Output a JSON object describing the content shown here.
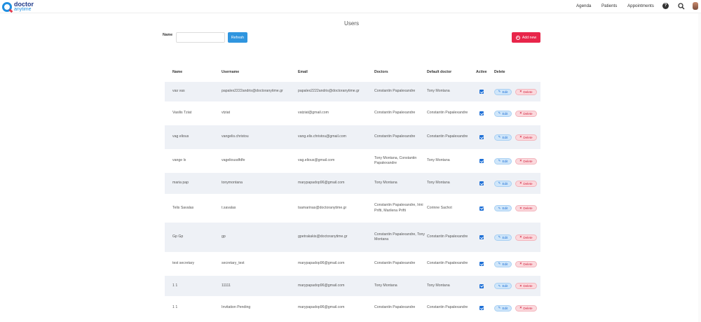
{
  "brand": {
    "main": "doctor",
    "sub": "anytime",
    "accent": "#1f8fe0",
    "brand_red": "#e8254a"
  },
  "nav": {
    "agenda": "Agenda",
    "patients": "Patients",
    "appointments": "Appointments",
    "help_icon": "question-circle-icon",
    "search_icon": "search-icon"
  },
  "page": {
    "title": "Users"
  },
  "filter": {
    "name_label": "Name",
    "name_value": "",
    "refresh_label": "Refresh",
    "add_label": "Add new"
  },
  "table": {
    "headers": {
      "name": "Name",
      "username": "Username",
      "email": "Email",
      "doctors": "Doctors",
      "default_doctor": "Default doctor",
      "active": "Active",
      "delete": "Delete"
    },
    "edit_label": "Edit",
    "delete_label": "Delete",
    "rows": [
      {
        "name": "vas vas",
        "username": "papalex2222andris@doctoranytime.gr",
        "email": "papalex2222andris@doctoranytime.gr",
        "doctors": "Constantin Papalexandre",
        "default_doctor": "Tony Montana",
        "active": true
      },
      {
        "name": "Vasilis Tziat",
        "username": "vtziat",
        "email": "vatziat@gmail.com",
        "doctors": "Constantin Papalexandre",
        "default_doctor": "Constantin Papalexandre",
        "active": true
      },
      {
        "name": "vag elious",
        "username": "vangelis.christou",
        "email": "vang.elis.christou@gmail.com",
        "doctors": "Constantin Papalexandre",
        "default_doctor": "Constantin Papalexandre",
        "active": true
      },
      {
        "name": "vange lx",
        "username": "vageliousdfdfe",
        "email": "vag.elious@gmail.com",
        "doctors": "Tony Montana, Constantin Papalexandre",
        "default_doctor": "Tony Montana",
        "active": true
      },
      {
        "name": "maria pap",
        "username": "tonymontana",
        "email": "marypapadop96@gmail.com",
        "doctors": "Tony Montana",
        "default_doctor": "Tony Montana",
        "active": true
      },
      {
        "name": "Telis Savalas",
        "username": "t.savalas",
        "email": "tsamarinas@doctoranytime.gr",
        "doctors": "Constantin Papalexandre, Irini Prifti, Marilena Prifti",
        "default_doctor": "Corinne Sachot",
        "active": true
      },
      {
        "name": "Gp Gp",
        "username": "gp",
        "email": "gpetrakakis@doctoranytime.gr",
        "doctors": "Constantin Papalexandre, Tony Montana",
        "default_doctor": "Constantin Papalexandre",
        "active": true
      },
      {
        "name": "test secretary",
        "username": "secretary_test",
        "email": "marypapadop96@gmail.com",
        "doctors": "Constantin Papalexandre",
        "default_doctor": "Constantin Papalexandre",
        "active": true
      },
      {
        "name": "1 1",
        "username": "11111",
        "email": "marypapadop96@gmail.com",
        "doctors": "Tony Montana",
        "default_doctor": "Tony Montana",
        "active": true
      },
      {
        "name": "1 1",
        "username": "Invitation Pending",
        "email": "marypapadop96@gmail.com",
        "doctors": "Constantin Papalexandre",
        "default_doctor": "Constantin Papalexandre",
        "active": true
      }
    ]
  }
}
